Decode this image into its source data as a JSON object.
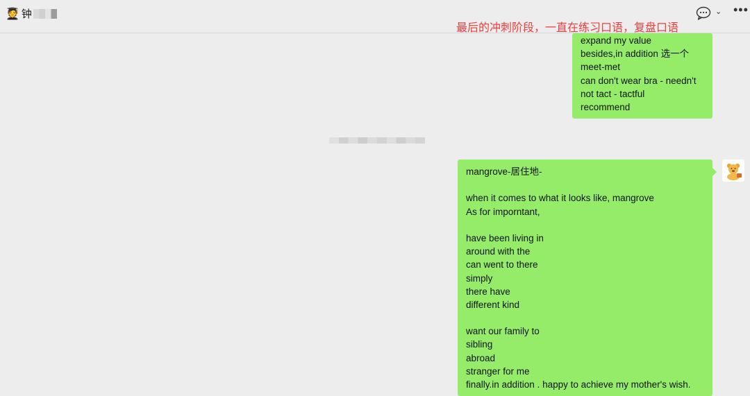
{
  "header": {
    "contact_emoji": "🧑‍🎓",
    "contact_name": "钟"
  },
  "annotation": "最后的冲刺阶段，一直在练习口语，复盘口语",
  "messages": [
    {
      "lines": [
        "expand my value",
        "besides,in addition 选一个",
        "meet-met",
        "can don't wear bra - needn't",
        "not tact - tactful",
        "recommend"
      ]
    },
    {
      "lines": [
        "mangrove-居住地-",
        "",
        "when it comes to what it looks like, mangrove",
        "As for imporntant,",
        "",
        "have been living in",
        "around with the",
        "can went to there",
        "simply",
        "there have",
        "different kind",
        "",
        "want our family to",
        "sibling",
        "abroad",
        "stranger for me",
        "finally.in addition . happy to achieve my mother's wish."
      ]
    }
  ],
  "colors": {
    "bubble": "#95ec69",
    "annotation": "#f03d3d",
    "background": "#ededed"
  },
  "icons": [
    "chat-bubble-icon",
    "chevron-down-icon",
    "more-icon"
  ]
}
